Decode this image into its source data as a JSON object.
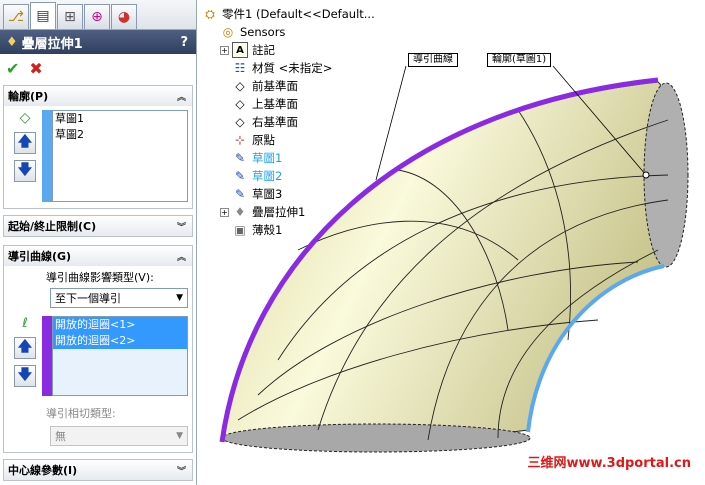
{
  "feature_panel": {
    "title": "疊層拉伸1",
    "help": "?",
    "ok": "✔",
    "cancel": "✖",
    "tabs": [
      "feature-manager",
      "property-manager",
      "configuration-manager",
      "dimxpert",
      "display-manager"
    ],
    "profiles": {
      "header": "輪廓(P)",
      "items": [
        "草圖1",
        "草圖2"
      ]
    },
    "start_end": {
      "header": "起始/終止限制(C)"
    },
    "guide_curves": {
      "header": "導引曲線(G)",
      "influence_label": "導引曲線影響類型(V):",
      "influence_value": "至下一個導引",
      "items": [
        "開放的迴圈<1>",
        "開放的迴圈<2>"
      ],
      "tangency_label": "導引相切類型:",
      "tangency_value": "無"
    },
    "centerline": {
      "header": "中心線參數(I)"
    }
  },
  "tree": {
    "root": "零件1  (Default<<Default...",
    "items": [
      {
        "label": "Sensors",
        "icon": "sensor-icon"
      },
      {
        "label": "註記",
        "icon": "annotation-icon"
      },
      {
        "label": "材質 <未指定>",
        "icon": "material-icon"
      },
      {
        "label": "前基準面",
        "icon": "plane-icon"
      },
      {
        "label": "上基準面",
        "icon": "plane-icon"
      },
      {
        "label": "右基準面",
        "icon": "plane-icon"
      },
      {
        "label": "原點",
        "icon": "origin-icon"
      },
      {
        "label": "草圖1",
        "icon": "sketch-icon",
        "highlight": true
      },
      {
        "label": "草圖2",
        "icon": "sketch-icon",
        "highlight": true
      },
      {
        "label": "草圖3",
        "icon": "sketch-icon"
      },
      {
        "label": "疊層拉伸1",
        "icon": "loft-icon"
      },
      {
        "label": "薄殼1",
        "icon": "shell-icon"
      }
    ]
  },
  "callouts": {
    "guide": "導引曲線",
    "profile": "輪廓(草圖1)"
  },
  "watermark": "三维网www.3dportal.cn",
  "colors": {
    "guide_curve": "#8a2be2",
    "profile": "#5aa8f0",
    "highlight_text": "#1ea0f0",
    "panel_header": "#3b4b6e"
  }
}
